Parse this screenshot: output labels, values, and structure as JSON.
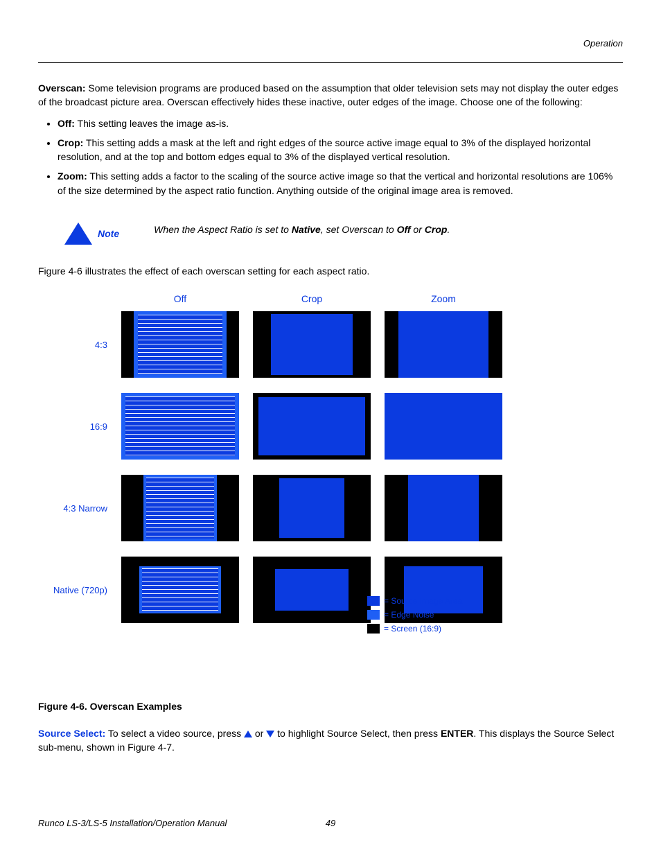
{
  "header": {
    "section": "Operation"
  },
  "overscan": {
    "title": "Overscan:",
    "desc": "Some television programs are produced based on the assumption that older television sets may not display the outer edges of the broadcast picture area. Overscan effectively hides these inactive, outer edges of the image. Choose one of the following:",
    "items": {
      "off": {
        "name": "Off:",
        "text": " This setting leaves the image as-is."
      },
      "crop": {
        "name": "Crop:",
        "text": " This setting adds a mask at the left and right edges of the source active image equal to 3% of the displayed horizontal resolution, and at the top and bottom edges equal to 3% of the displayed vertical resolution."
      },
      "zoom": {
        "name": "Zoom:",
        "text": " This setting adds a factor to the scaling of the source active image so that the vertical and horizontal resolutions are 106% of the size determined by the aspect ratio function. Anything outside of the original image area is removed."
      }
    }
  },
  "note": {
    "label": "Note",
    "pre": "When the Aspect Ratio is set to ",
    "native": "Native",
    "mid": ", set Overscan to ",
    "off": "Off",
    "or": " or ",
    "crop": "Crop",
    "end": "."
  },
  "fig_intro": "Figure 4-6 illustrates the effect of each overscan setting for each aspect ratio.",
  "diagram": {
    "cols": {
      "off": "Off",
      "crop": "Crop",
      "zoom": "Zoom"
    },
    "rows": {
      "r1": "4:3",
      "r2": "16:9",
      "r3": "4:3 Narrow",
      "r4": "Native (720p)"
    },
    "legend": {
      "img": "= Source Image Area",
      "noise": "= Edge Noise",
      "screen": "= Screen (16:9)"
    },
    "caption": "Figure 4-6. Overscan Examples"
  },
  "source_select": {
    "label": "Source Select:",
    "t1": " To select a video source, press ",
    "t2": " or ",
    "t3": " to highlight Source Select, then press ",
    "enter": "ENTER",
    "t4": ". This displays the Source Select sub-menu, shown in Figure 4-7."
  },
  "footer": {
    "doc": "Runco LS-3/LS-5 Installation/Operation Manual",
    "page": "49"
  }
}
